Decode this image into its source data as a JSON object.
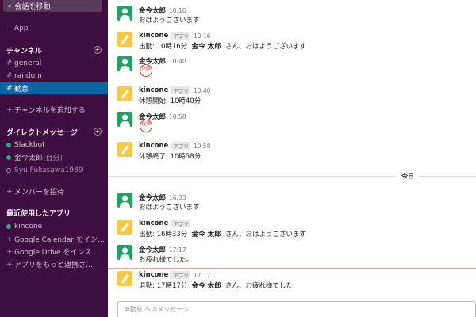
{
  "sidebar": {
    "jump_label": "会話を移動",
    "apps_label": "App",
    "channels_header": "チャンネル",
    "channels": [
      {
        "name": "general",
        "active": false
      },
      {
        "name": "random",
        "active": false
      },
      {
        "name": "勤怠",
        "active": true
      }
    ],
    "add_channel": "チャンネルを追加する",
    "dm_header": "ダイレクトメッセージ",
    "dms": [
      {
        "name": "Slackbot",
        "online": true
      },
      {
        "name": "金今太郎",
        "suffix": "(自分)",
        "online": true
      },
      {
        "name": "Syu Fukasawa1989",
        "online": false
      }
    ],
    "invite": "メンバーを招待",
    "recent_apps_header": "最近使用したアプリ",
    "apps": [
      {
        "name": "kincone",
        "online": true
      },
      {
        "name": "Google Calendar をイン…"
      },
      {
        "name": "Google Drive をインス…"
      },
      {
        "name": "アプリをもっと連携さ…"
      }
    ]
  },
  "messages": [
    {
      "sender": "金今太郎",
      "time": "10:16",
      "kind": "user",
      "text": "おはようございます"
    },
    {
      "sender": "kincone",
      "time": "10:16",
      "kind": "bot",
      "tag": "アプリ",
      "pre": "出勤: 10時16分",
      "bold": "金今 太郎",
      "post": "さん、おはようございます"
    },
    {
      "sender": "金今太郎",
      "time": "10:40",
      "kind": "user",
      "stamp": "休憩"
    },
    {
      "sender": "kincone",
      "time": "10:40",
      "kind": "bot",
      "tag": "アプリ",
      "text": "休憩開始: 10時40分"
    },
    {
      "sender": "金今太郎",
      "time": "10:58",
      "kind": "user",
      "stamp": "復帰"
    },
    {
      "sender": "kincone",
      "time": "10:58",
      "kind": "bot",
      "tag": "アプリ",
      "text": "休憩終了: 10時58分"
    },
    {
      "sender": "金今太郎",
      "time": "16:33",
      "kind": "user",
      "text": "おはようございます"
    },
    {
      "sender": "kincone",
      "time": "",
      "kind": "bot",
      "tag": "アプリ",
      "pre": "出勤: 16時33分",
      "bold": "金今 太郎",
      "post": "さん、おはようございます"
    },
    {
      "sender": "金今太郎",
      "time": "17:17",
      "kind": "user",
      "text": "お疲れ様でした。"
    },
    {
      "sender": "kincone",
      "time": "17:17",
      "kind": "bot",
      "tag": "アプリ",
      "pre": "退勤: 17時17分",
      "bold": "金今 太郎",
      "post": "さん、お疲れ様でした"
    }
  ],
  "day_divider": "今日",
  "composer": {
    "placeholder": "#勤怠 へのメッセージ"
  },
  "colors": {
    "sidebar": "#3f0e40",
    "active": "#1164a3",
    "online": "#2bac76",
    "stamp": "#dd3333"
  }
}
